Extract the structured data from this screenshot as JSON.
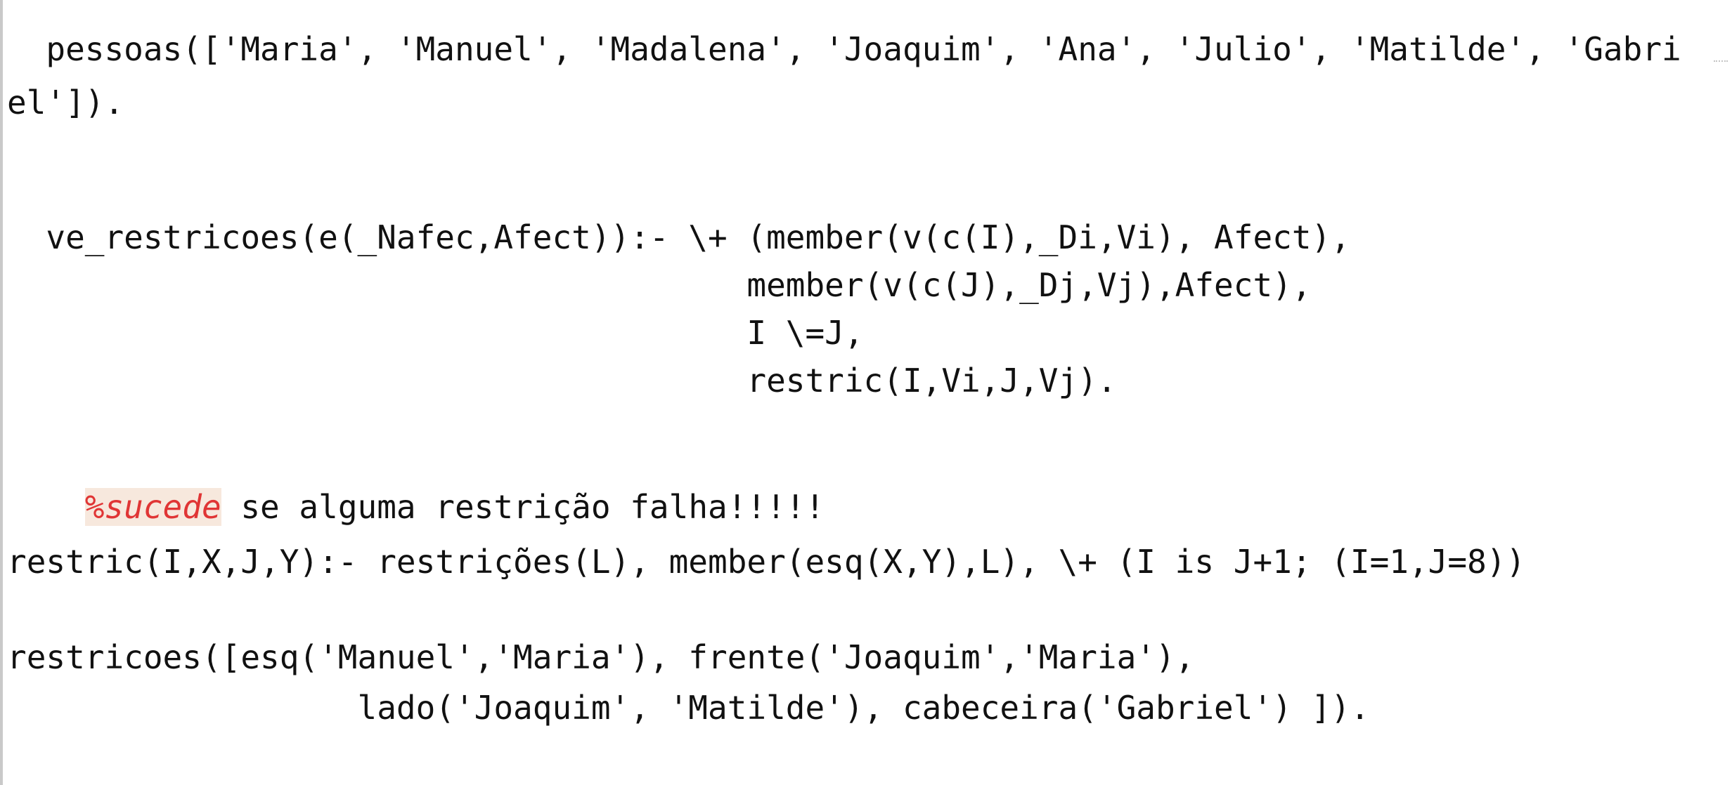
{
  "code_lines": [
    "  pessoas(['Maria', 'Manuel', 'Madalena', 'Joaquim', 'Ana', 'Julio', 'Matilde', 'Gabri",
    "el']).",
    "  ve_restricoes(e(_Nafec,Afect)):- \\+ (member(v(c(I),_Di,Vi), Afect),",
    "                                      member(v(c(J),_Dj,Vj),Afect),",
    "                                      I \\=J,",
    "                                      restric(I,Vi,J,Vj).",
    "%sucede",
    " se alguma restrição falha!!!!!",
    "restric(I,X,J,Y):- restrições(L), member(esq(X,Y),L), \\+ (I is J+1; (I=1,J=8))",
    "restricoes([esq('Manuel','Maria'), frente('Joaquim','Maria'),",
    "                  lado('Joaquim', 'Matilde'), cabeceira('Gabriel') ])."
  ]
}
